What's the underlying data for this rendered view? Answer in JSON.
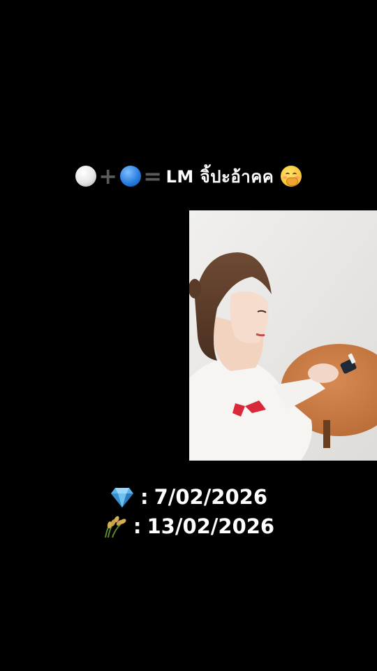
{
  "caption": {
    "icons": [
      "white-circle-icon",
      "plus-icon",
      "blue-circle-icon",
      "equals-icon"
    ],
    "text": "LM จิ้ปะอ้าคค",
    "plus_symbol": "+",
    "equals_symbol": "=",
    "trailing_icon": "face-with-hand-over-mouth-icon"
  },
  "video": {
    "description_icon": "video-frame"
  },
  "dates": [
    {
      "icon": "gem-icon",
      "separator": ":",
      "value": "7/02/2026"
    },
    {
      "icon": "sheaf-of-rice-icon",
      "separator": ":",
      "value": "13/02/2026"
    }
  ],
  "colors": {
    "background": "#000000",
    "text": "#ffffff",
    "operator": "#5a5a5a",
    "blue_circle": "#2b7fe0",
    "gem": "#5ab4ea",
    "rice": "#c9a24a"
  }
}
